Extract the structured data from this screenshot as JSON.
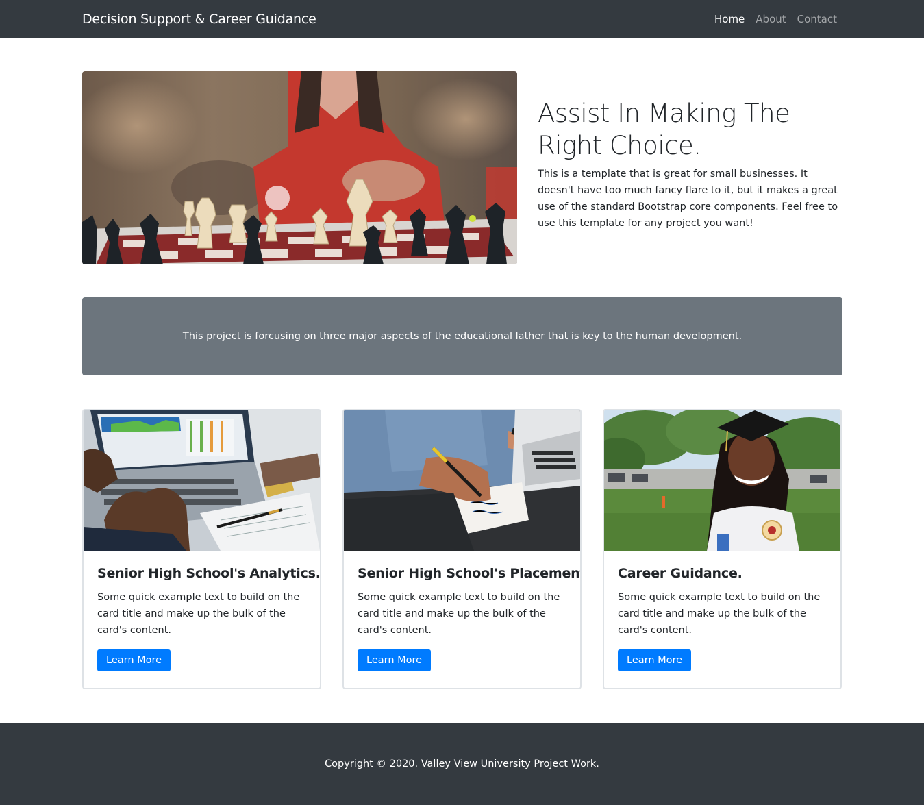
{
  "navbar": {
    "brand": "Decision Support & Career Guidance",
    "links": [
      {
        "label": "Home",
        "active": true
      },
      {
        "label": "About",
        "active": false
      },
      {
        "label": "Contact",
        "active": false
      }
    ]
  },
  "hero": {
    "image": "chess-board-photo",
    "title": "Assist In Making The Right Choice.",
    "description": "This is a template that is great for small businesses. It doesn't have too much fancy flare to it, but it makes a great use of the standard Bootstrap core components. Feel free to use this template for any project you want!"
  },
  "banner": {
    "text": "This project is forcusing on three major aspects of the educational lather that is key to the human development."
  },
  "cards": [
    {
      "image": "laptop-analytics-photo",
      "title": "Senior High School's Analytics.",
      "text": "Some quick example text to build on the card title and make up the bulk of the card's content.",
      "button": "Learn More"
    },
    {
      "image": "writing-notes-photo",
      "title": "Senior High School's Placement..",
      "text": "Some quick example text to build on the card title and make up the bulk of the card's content.",
      "button": "Learn More"
    },
    {
      "image": "graduate-photo",
      "title": "Career Guidance.",
      "text": "Some quick example text to build on the card title and make up the bulk of the card's content.",
      "button": "Learn More"
    }
  ],
  "footer": {
    "text": "Copyright © 2020. Valley View University Project Work."
  },
  "colors": {
    "navbar": "#343a40",
    "banner": "#6c757d",
    "button": "#007bff",
    "footer": "#343a40"
  }
}
